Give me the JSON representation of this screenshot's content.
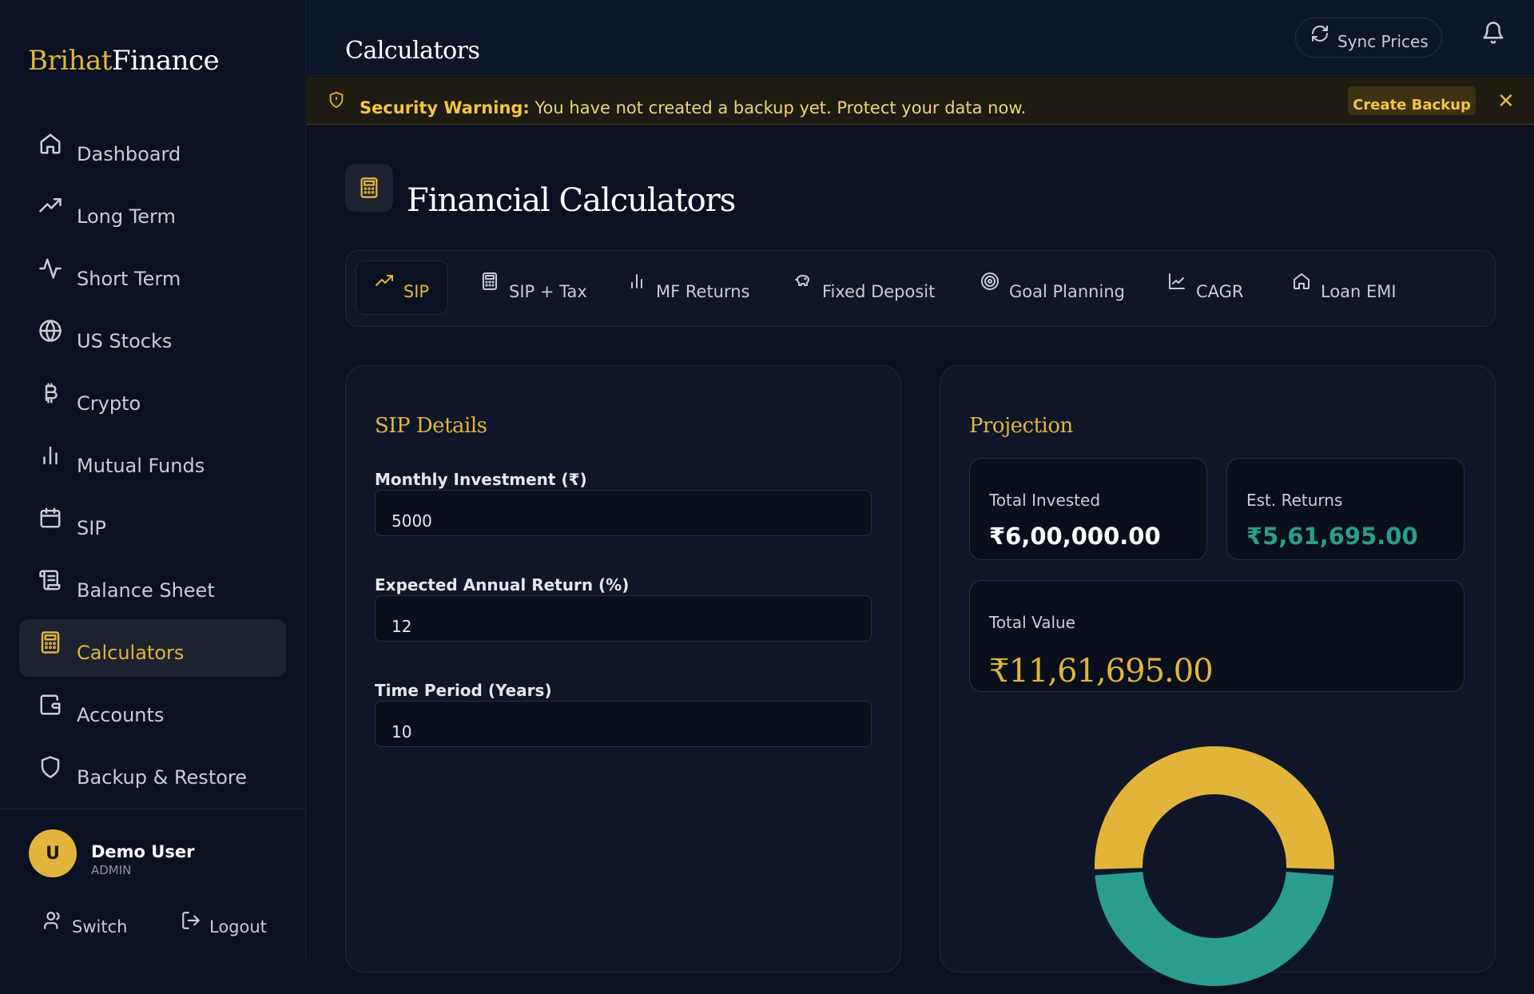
{
  "app": {
    "logo_part1": "Brihat",
    "logo_part2": "Finance"
  },
  "sidebar": {
    "items": [
      {
        "label": "Dashboard",
        "icon": "home-icon"
      },
      {
        "label": "Long Term",
        "icon": "trending-up-icon"
      },
      {
        "label": "Short Term",
        "icon": "activity-icon"
      },
      {
        "label": "US Stocks",
        "icon": "globe-icon"
      },
      {
        "label": "Crypto",
        "icon": "bitcoin-icon"
      },
      {
        "label": "Mutual Funds",
        "icon": "bar-chart-icon"
      },
      {
        "label": "SIP",
        "icon": "calendar-icon"
      },
      {
        "label": "Balance Sheet",
        "icon": "scroll-icon"
      },
      {
        "label": "Calculators",
        "icon": "calculator-icon",
        "active": true
      },
      {
        "label": "Accounts",
        "icon": "wallet-icon"
      },
      {
        "label": "Backup & Restore",
        "icon": "shield-icon"
      }
    ],
    "user": {
      "initial": "U",
      "name": "Demo User",
      "role": "ADMIN"
    },
    "switch_label": "Switch",
    "logout_label": "Logout"
  },
  "header": {
    "title": "Calculators",
    "sync_label": "Sync Prices"
  },
  "warning": {
    "bold": "Security Warning:",
    "text": " You have not created a backup yet. Protect your data now.",
    "button": "Create Backup",
    "close": "✕"
  },
  "main": {
    "title": "Financial Calculators",
    "tabs": [
      {
        "label": "SIP",
        "icon": "trending-up-icon",
        "active": true
      },
      {
        "label": "SIP + Tax",
        "icon": "calculator-icon"
      },
      {
        "label": "MF Returns",
        "icon": "bar-chart-icon"
      },
      {
        "label": "Fixed Deposit",
        "icon": "piggy-bank-icon"
      },
      {
        "label": "Goal Planning",
        "icon": "target-icon"
      },
      {
        "label": "CAGR",
        "icon": "line-chart-icon"
      },
      {
        "label": "Loan EMI",
        "icon": "home-icon"
      }
    ],
    "details": {
      "title": "SIP Details",
      "fields": [
        {
          "label": "Monthly Investment (₹)",
          "value": "5000"
        },
        {
          "label": "Expected Annual Return (%)",
          "value": "12"
        },
        {
          "label": "Time Period (Years)",
          "value": "10"
        }
      ]
    },
    "projection": {
      "title": "Projection",
      "invested_label": "Total Invested",
      "invested_value": "₹6,00,000.00",
      "returns_label": "Est. Returns",
      "returns_value": "₹5,61,695.00",
      "total_label": "Total Value",
      "total_value": "₹11,61,695.00",
      "donut": {
        "invested": 600000,
        "returns": 561695,
        "invested_color": "#e2b53a",
        "returns_color": "#2a9d8f"
      }
    }
  },
  "colors": {
    "accent": "#e2b53a",
    "returns": "#2a9d8f",
    "background": "#0b1120"
  }
}
